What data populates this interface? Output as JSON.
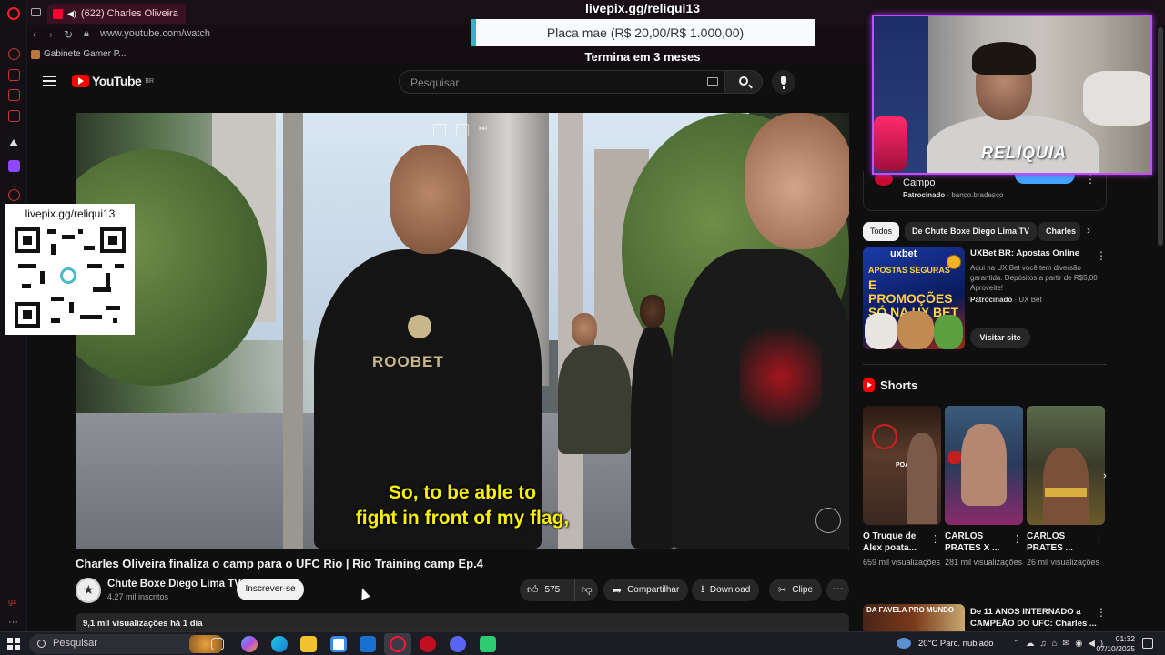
{
  "browser": {
    "tab_title": "(622) Charles Oliveira",
    "new_tab": "+",
    "url": "www.youtube.com/watch",
    "bookmark": "Gabinete Gamer P..."
  },
  "livepix_top": {
    "url": "livepix.gg/reliqui13",
    "goal": "Placa mae (R$ 20,00/R$ 1.000,00)",
    "ends": "Termina em 3 meses"
  },
  "qr_overlay": {
    "url": "livepix.gg/reliqui13"
  },
  "youtube": {
    "logo_word": "YouTube",
    "region": "BR",
    "search_placeholder": "Pesquisar"
  },
  "video": {
    "subtitle_line1": "So, to be able to",
    "subtitle_line2": "fight in front of my flag,",
    "shirt_text": "ROOBET",
    "title": "Charles Oliveira finaliza o camp para o UFC Rio | Rio Training camp Ep.4",
    "channel_name": "Chute Boxe Diego Lima TV",
    "subscribers": "4,27 mil inscritos",
    "subscribe_label": "Inscrever-se",
    "likes": "575",
    "share_label": "Compartilhar",
    "download_label": "Download",
    "clip_label": "Clipe",
    "views_date": "9,1 mil visualizações  há 1 dia"
  },
  "webcam": {
    "brand": "RELIQUIA"
  },
  "sidebar": {
    "ad_top": {
      "title": "Campo",
      "sponsored": "Patrocinado",
      "domain": "· banco.bradesco"
    },
    "chips": [
      "Todos",
      "De Chute Boxe Diego Lima TV",
      "Charles"
    ],
    "ad_uxbet": {
      "img_brand": "uxbet",
      "img_line1": "APOSTAS SEGURAS",
      "img_line2": "E PROMOÇÕES SÓ NA UX BET",
      "title": "UXBet BR: Apostas Online",
      "description": "Aqui na UX Bet você tem diversão garantida. Depósitos a partir de R$5,00 Aproveite!",
      "sponsored": "Patrocinado",
      "advertiser": "· UX Bet",
      "visit_label": "Visitar site"
    },
    "shorts_heading": "Shorts",
    "shorts": [
      {
        "title": "O Truque de Alex poata...",
        "views": "659 mil visualizações",
        "caption": "POATAN"
      },
      {
        "title": "CARLOS PRATES X ...",
        "views": "281 mil visualizações",
        "caption": ""
      },
      {
        "title": "CARLOS PRATES ...",
        "views": "26 mil visualizações",
        "caption": ""
      }
    ],
    "related": {
      "thumb_text": "DA FAVELA PRO MUNDO",
      "title": "De 11 ANOS INTERNADO a CAMPEÃO DO UFC: Charles ..."
    }
  },
  "taskbar": {
    "search_placeholder": "Pesquisar",
    "weather": "20°C  Parc. nublado",
    "time": "01:32",
    "date": "07/10/2025"
  },
  "colors": {
    "yt_red": "#ff0000",
    "subtitle_yellow": "#f7f100",
    "webcam_border": "#c050ff",
    "livepix_accent": "#37b2c2"
  }
}
